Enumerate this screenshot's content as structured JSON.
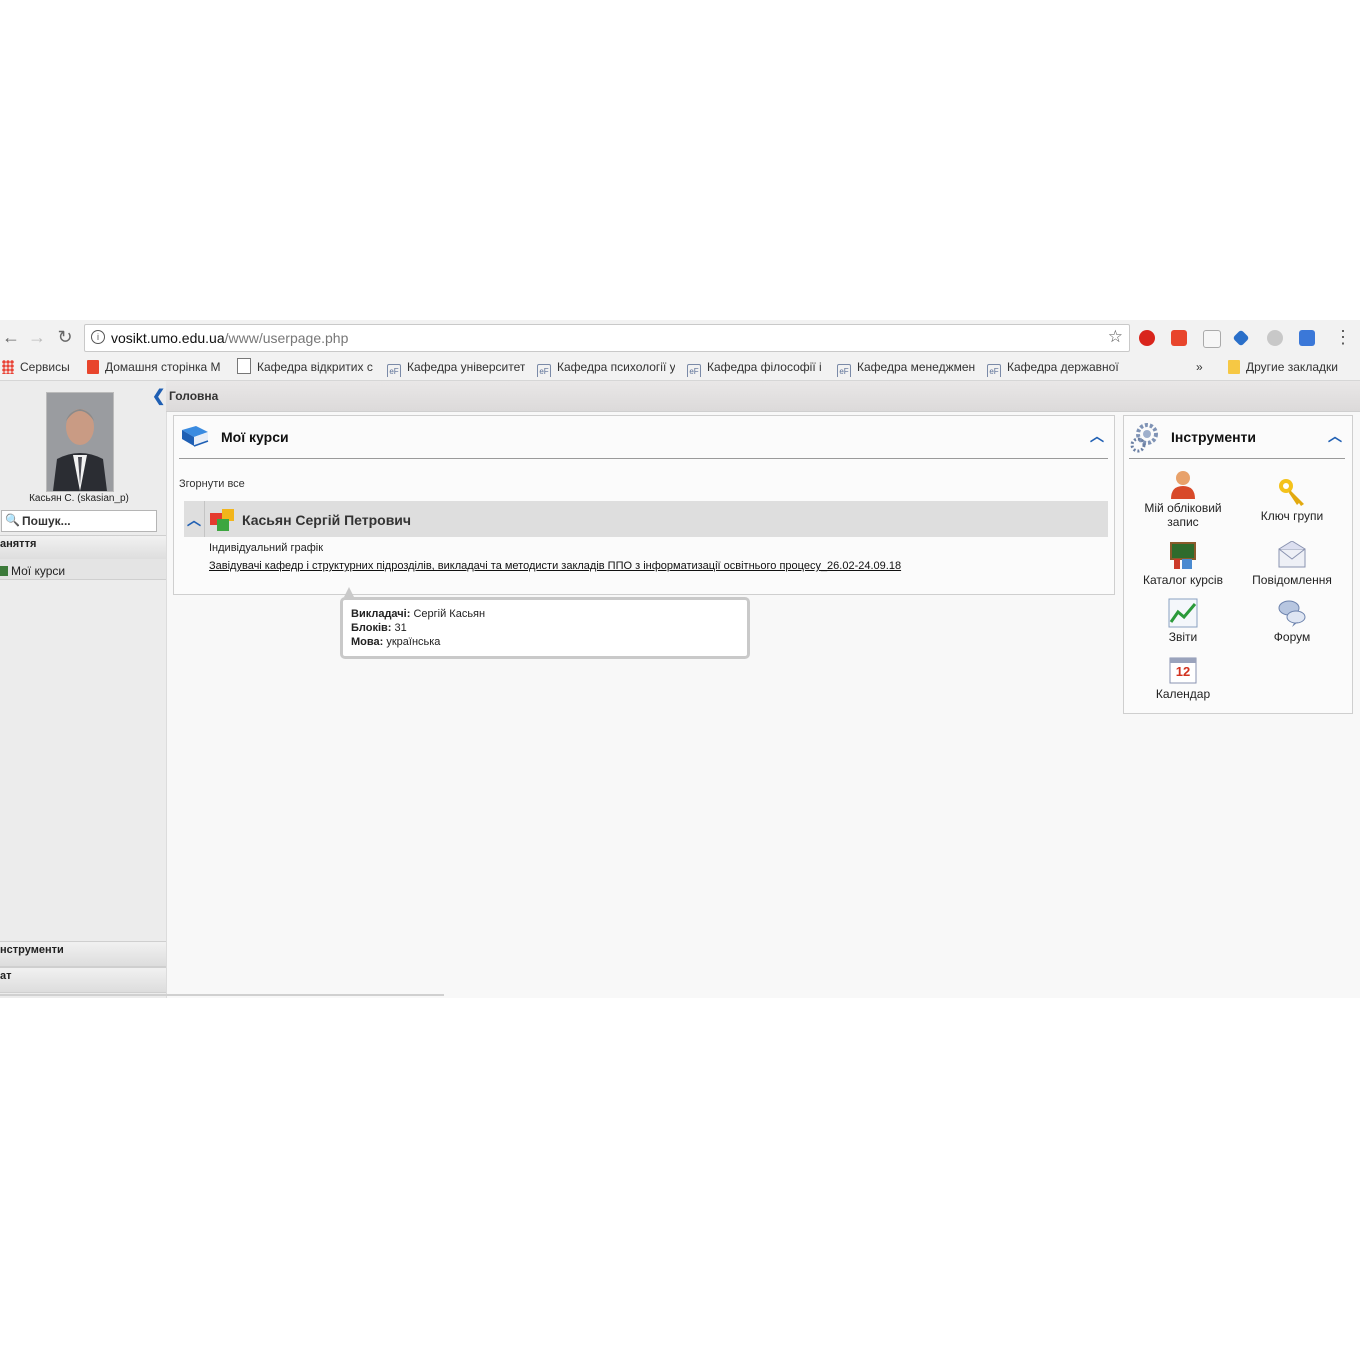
{
  "browser": {
    "url_host": "vosikt.umo.edu.ua",
    "url_path": "/www/userpage.php",
    "bookmarks": [
      {
        "label": "Сервисы",
        "icon": "apps-icon"
      },
      {
        "label": "Домашня сторінка M",
        "icon": "office-icon"
      },
      {
        "label": "Кафедра відкритих с",
        "icon": "page-icon"
      },
      {
        "label": "Кафедра університет",
        "icon": "ef-icon"
      },
      {
        "label": "Кафедра психології у",
        "icon": "ef-icon"
      },
      {
        "label": "Кафедра філософії і",
        "icon": "ef-icon"
      },
      {
        "label": "Кафедра менеджмен",
        "icon": "ef-icon"
      },
      {
        "label": "Кафедра державної",
        "icon": "ef-icon"
      }
    ],
    "overflow": "»",
    "other_bookmarks": "Другие закладки",
    "ef_glyph": "eF"
  },
  "breadcrumb": {
    "home": "Головна"
  },
  "sidebar": {
    "username": "Касьян С. (skasian_p)",
    "search_placeholder": "Пошук...",
    "section_lessons": "аняття",
    "my_courses": "Мої курси",
    "section_tools": "нструменти",
    "section_chat": "ат"
  },
  "courses": {
    "title": "Мої курси",
    "collapse_all": "Згорнути все",
    "teacher": "Касьян Сергій Петрович",
    "schedule": "Індивідуальний графік",
    "course_link": "Завідувачі кафедр і структурних підрозділів, викладачі та методисти закладів ППО з інформатизації освітнього процесу_26.02-24.09.18"
  },
  "tooltip": {
    "teachers_label": "Викладачі:",
    "teachers_value": "Сергій Касьян",
    "blocks_label": "Блоків:",
    "blocks_value": "31",
    "lang_label": "Мова:",
    "lang_value": "українська"
  },
  "tools": {
    "title": "Інструменти",
    "items": [
      {
        "label": "Мій обліковий запис",
        "icon": "user-icon"
      },
      {
        "label": "Ключ групи",
        "icon": "key-icon"
      },
      {
        "label": "Каталог курсів",
        "icon": "catalog-icon"
      },
      {
        "label": "Повідомлення",
        "icon": "envelope-icon"
      },
      {
        "label": "Звіти",
        "icon": "reports-icon"
      },
      {
        "label": "Форум",
        "icon": "forum-icon"
      },
      {
        "label": "Календар",
        "icon": "calendar-icon"
      }
    ],
    "calendar_day": "12"
  },
  "colors": {
    "accent": "#1f5fb3",
    "panel_border": "#cfcfcf"
  }
}
